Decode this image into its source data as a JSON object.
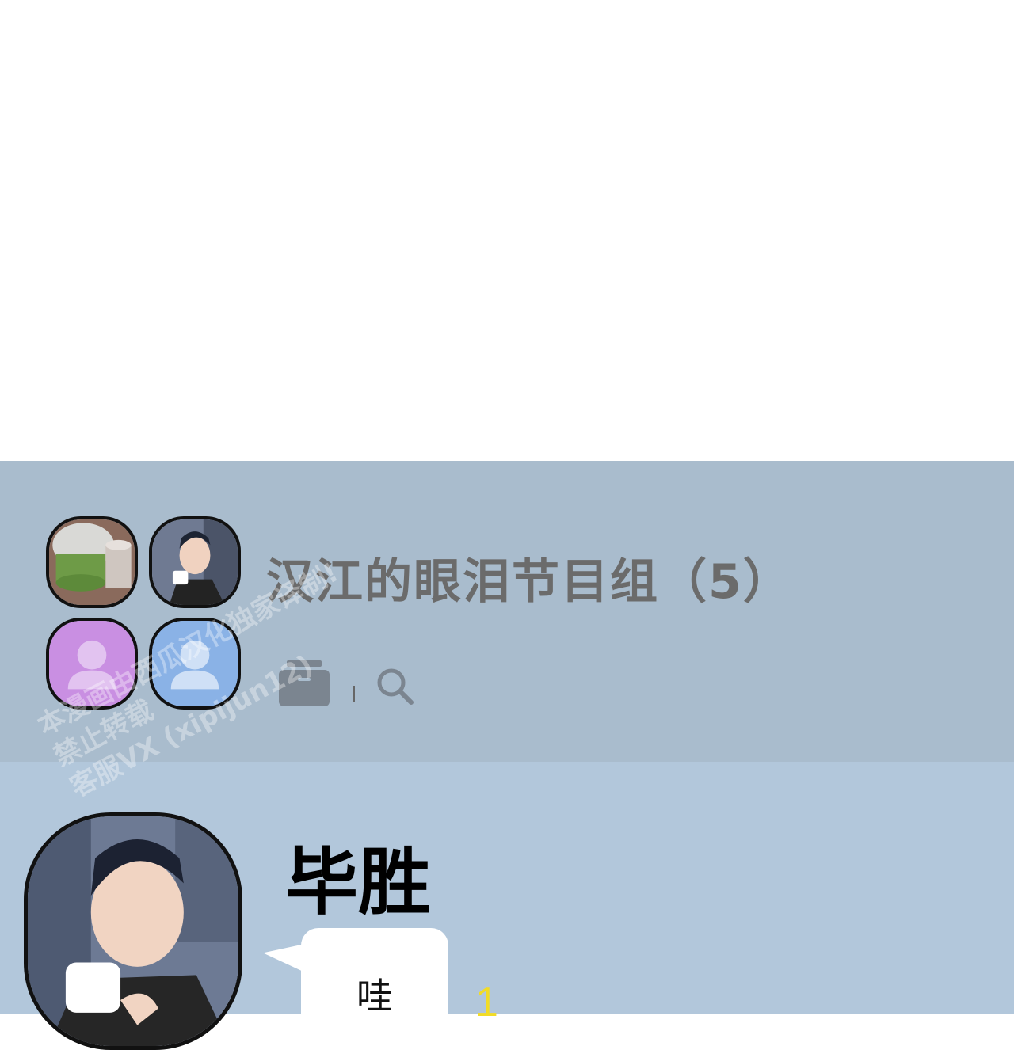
{
  "chat_room": {
    "title": "汉江的眼泪节目组（5）",
    "member_count": 5,
    "header_avatars": [
      "photo-cups",
      "photo-man",
      "default-user-purple",
      "default-user-blue"
    ],
    "toolbar_icons": [
      "archive-icon",
      "search-icon"
    ]
  },
  "message": {
    "sender": "毕胜",
    "text": "哇",
    "unread_count": "1"
  },
  "watermark": {
    "lines": [
      "本漫画由西瓜汉化独家译制!",
      "禁止转载",
      "客服VX (xipijun12)"
    ]
  },
  "colors": {
    "header_bg": "#a9bccd",
    "chat_bg": "#b2c7db",
    "title_color": "#6b6b6b",
    "unread_color": "#f2dc26",
    "avatar_purple": "#c98fe2",
    "avatar_blue": "#8ab2e6"
  }
}
